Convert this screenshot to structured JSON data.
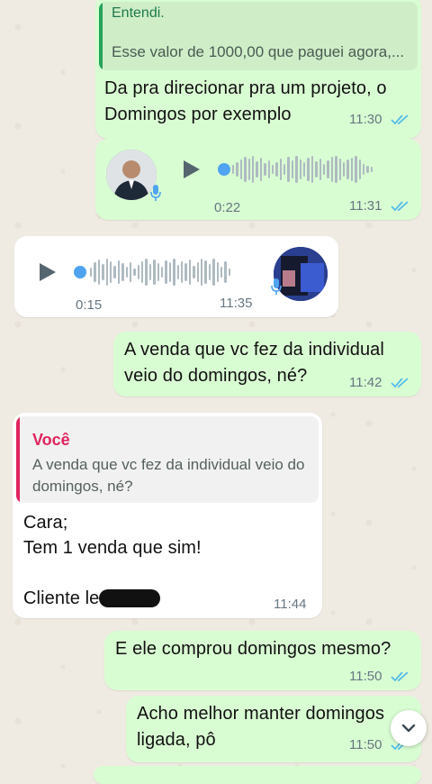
{
  "colors": {
    "outgoing_bubble": "#d9fdd3",
    "incoming_bubble": "#ffffff",
    "read_ticks": "#53bdeb",
    "quote_bar_outgoing": "#25a35a",
    "quote_bar_incoming": "#e0245e",
    "quote_author": "#e0245e",
    "voice_dot": "#4fa3f0"
  },
  "messages": [
    {
      "direction": "outgoing",
      "quote": {
        "author": "Entendi.",
        "text": "Esse valor de 1000,00 que paguei agora,..."
      },
      "text": "Da pra direcionar pra um projeto, o Domingos por exemplo",
      "time": "11:30",
      "status": "read"
    },
    {
      "direction": "outgoing",
      "type": "voice",
      "duration": "0:22",
      "time": "11:31",
      "status": "read",
      "avatar_icon": "profile-photo-man"
    },
    {
      "direction": "incoming",
      "type": "voice",
      "duration": "0:15",
      "time": "11:35",
      "avatar_icon": "profile-photo-contact"
    },
    {
      "direction": "outgoing",
      "text": "A venda que vc fez da individual veio do domingos, né?",
      "time": "11:42",
      "status": "read"
    },
    {
      "direction": "incoming",
      "quote": {
        "author": "Você",
        "text": "A venda que vc fez da individual veio do domingos, né?"
      },
      "lines": [
        "Cara;",
        "Tem 1 venda que sim!",
        "",
        "Cliente le"
      ],
      "time": "11:44"
    },
    {
      "direction": "outgoing",
      "text": "E ele comprou domingos mesmo?",
      "time": "11:50",
      "status": "read"
    },
    {
      "direction": "outgoing",
      "text": "Acho melhor manter domingos ligada, pô",
      "time": "11:50",
      "status": "read"
    }
  ],
  "scroll_button_icon": "chevron-down-icon"
}
